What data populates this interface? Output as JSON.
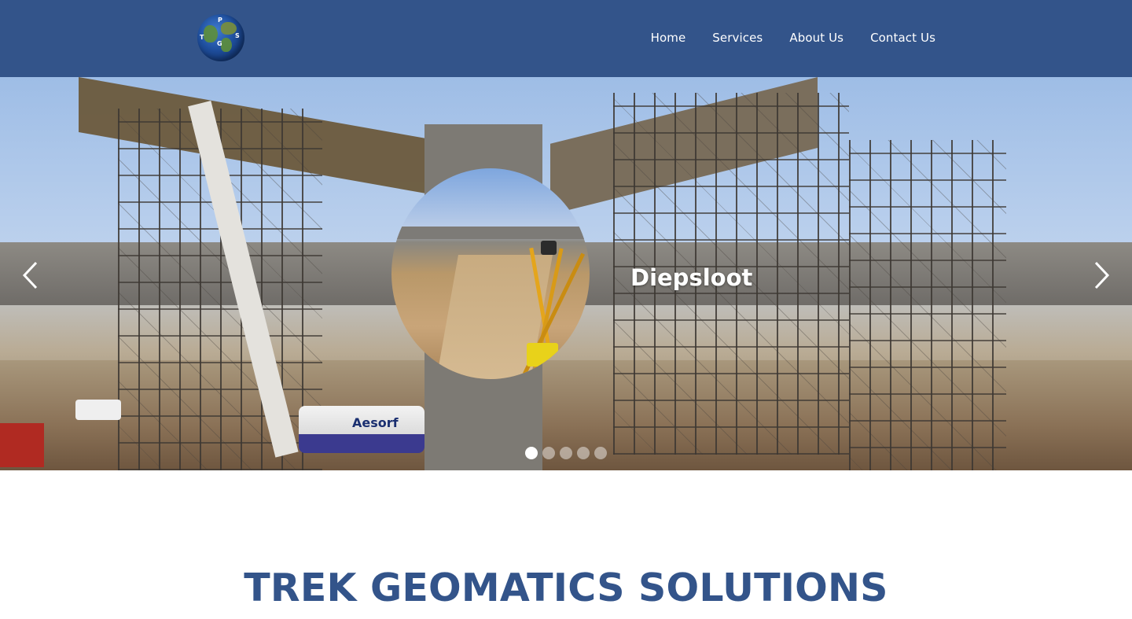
{
  "header": {
    "logo_letters": {
      "t": "T",
      "p": "P",
      "s": "S",
      "g": "G"
    },
    "nav": [
      {
        "label": "Home"
      },
      {
        "label": "Services"
      },
      {
        "label": "About Us"
      },
      {
        "label": "Contact Us"
      }
    ]
  },
  "hero": {
    "slide_caption": "Diepsloot",
    "truck_brand": "Aesorf",
    "prev_icon": "chevron-left-icon",
    "next_icon": "chevron-right-icon",
    "slide_count": 5,
    "active_slide": 1
  },
  "main": {
    "title": "TREK GEOMATICS SOLUTIONS"
  },
  "colors": {
    "brand": "#33548a",
    "white": "#ffffff"
  }
}
